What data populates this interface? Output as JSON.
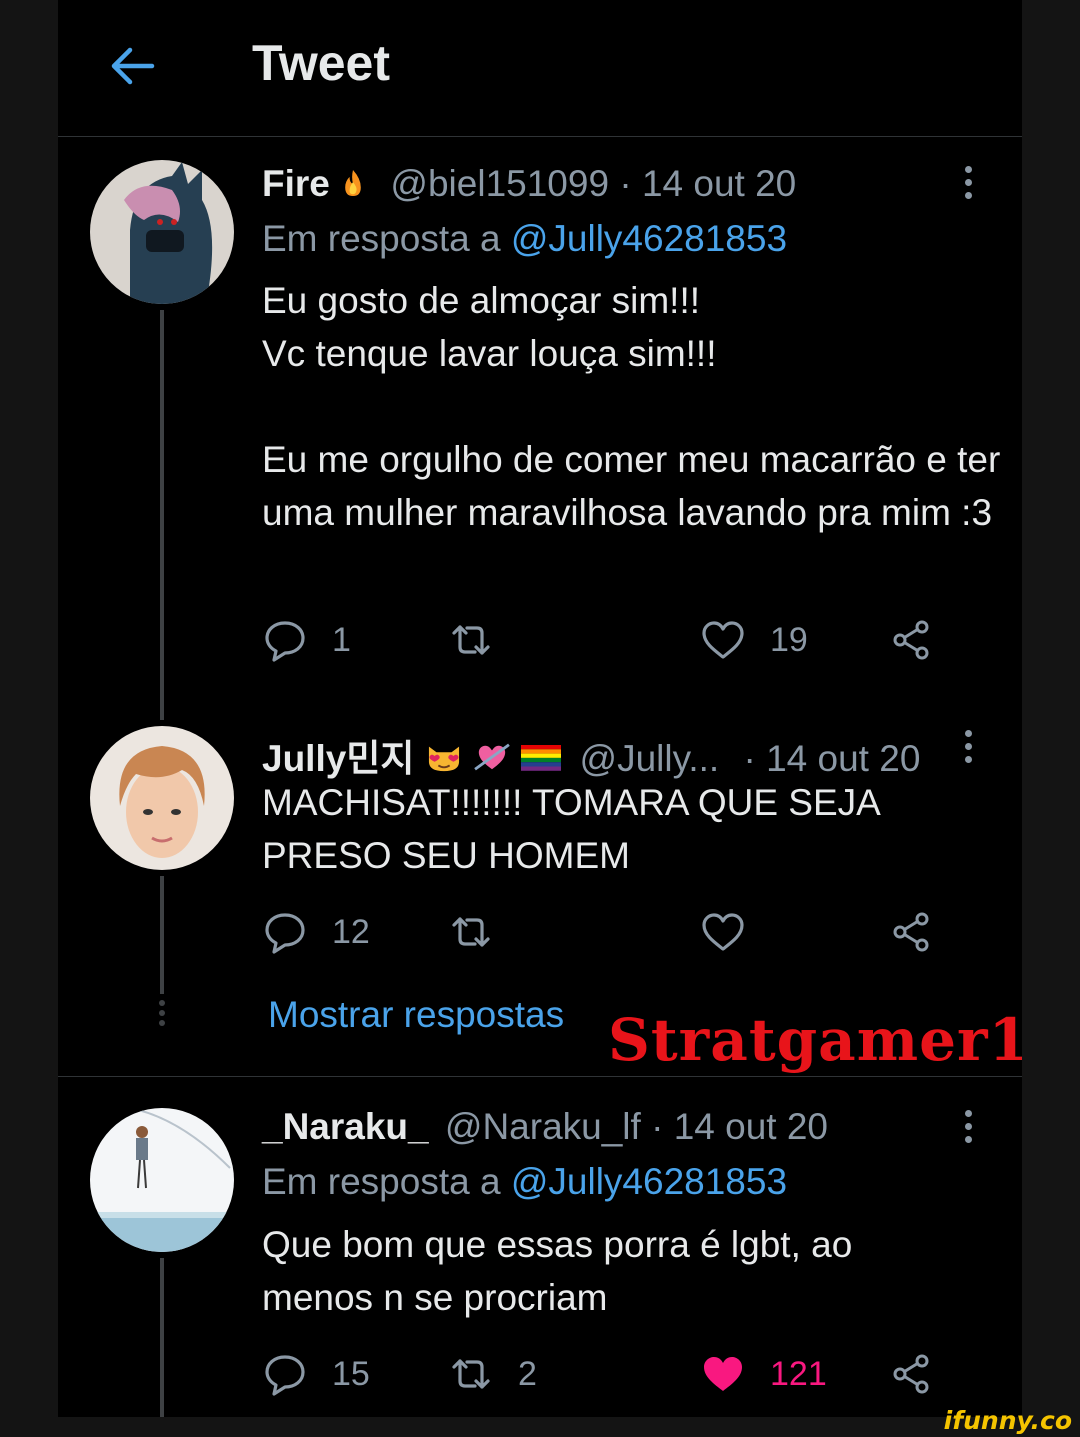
{
  "header": {
    "title": "Tweet"
  },
  "tweets": [
    {
      "name": "Fire",
      "name_emoji": "🔥",
      "handle": "@biel151099",
      "dot": "·",
      "date": "14 out 20",
      "reply_prefix": "Em resposta a",
      "reply_to": "@Jully46281853",
      "text": "Eu gosto de almoçar sim!!!\nVc tenque lavar louça sim!!!\n\nEu me orgulho de comer meu macarrão e ter uma mulher maravilhosa lavando pra mim :3",
      "replies": "1",
      "retweets": "",
      "likes": "19"
    },
    {
      "name": "Jully민지",
      "name_emoji": "😻💘",
      "handle": "@Jully...",
      "dot": "·",
      "date": "14 out 20",
      "text": "MACHISAT!!!!!!! TOMARA QUE SEJA PRESO SEU HOMEM",
      "replies": "12",
      "retweets": "",
      "likes": ""
    },
    {
      "name": "_Naraku_",
      "handle": "@Naraku_lf",
      "dot": "·",
      "date": "14 out 20",
      "reply_prefix": "Em resposta a",
      "reply_to": "@Jully46281853",
      "text": "Que bom que essas porra é lgbt, ao menos n se procriam",
      "replies": "15",
      "retweets": "2",
      "likes": "121"
    }
  ],
  "show_replies": "Mostrar respostas",
  "watermark": "Stratgamer1",
  "site_watermark": "ifunny.co",
  "colors": {
    "accent": "#4aa3ea",
    "like": "#f91880",
    "muted": "#8b98a5",
    "watermark": "#e8141a"
  },
  "icons": [
    "back-arrow-icon",
    "more-icon",
    "reply-icon",
    "retweet-icon",
    "heart-icon",
    "share-icon"
  ]
}
